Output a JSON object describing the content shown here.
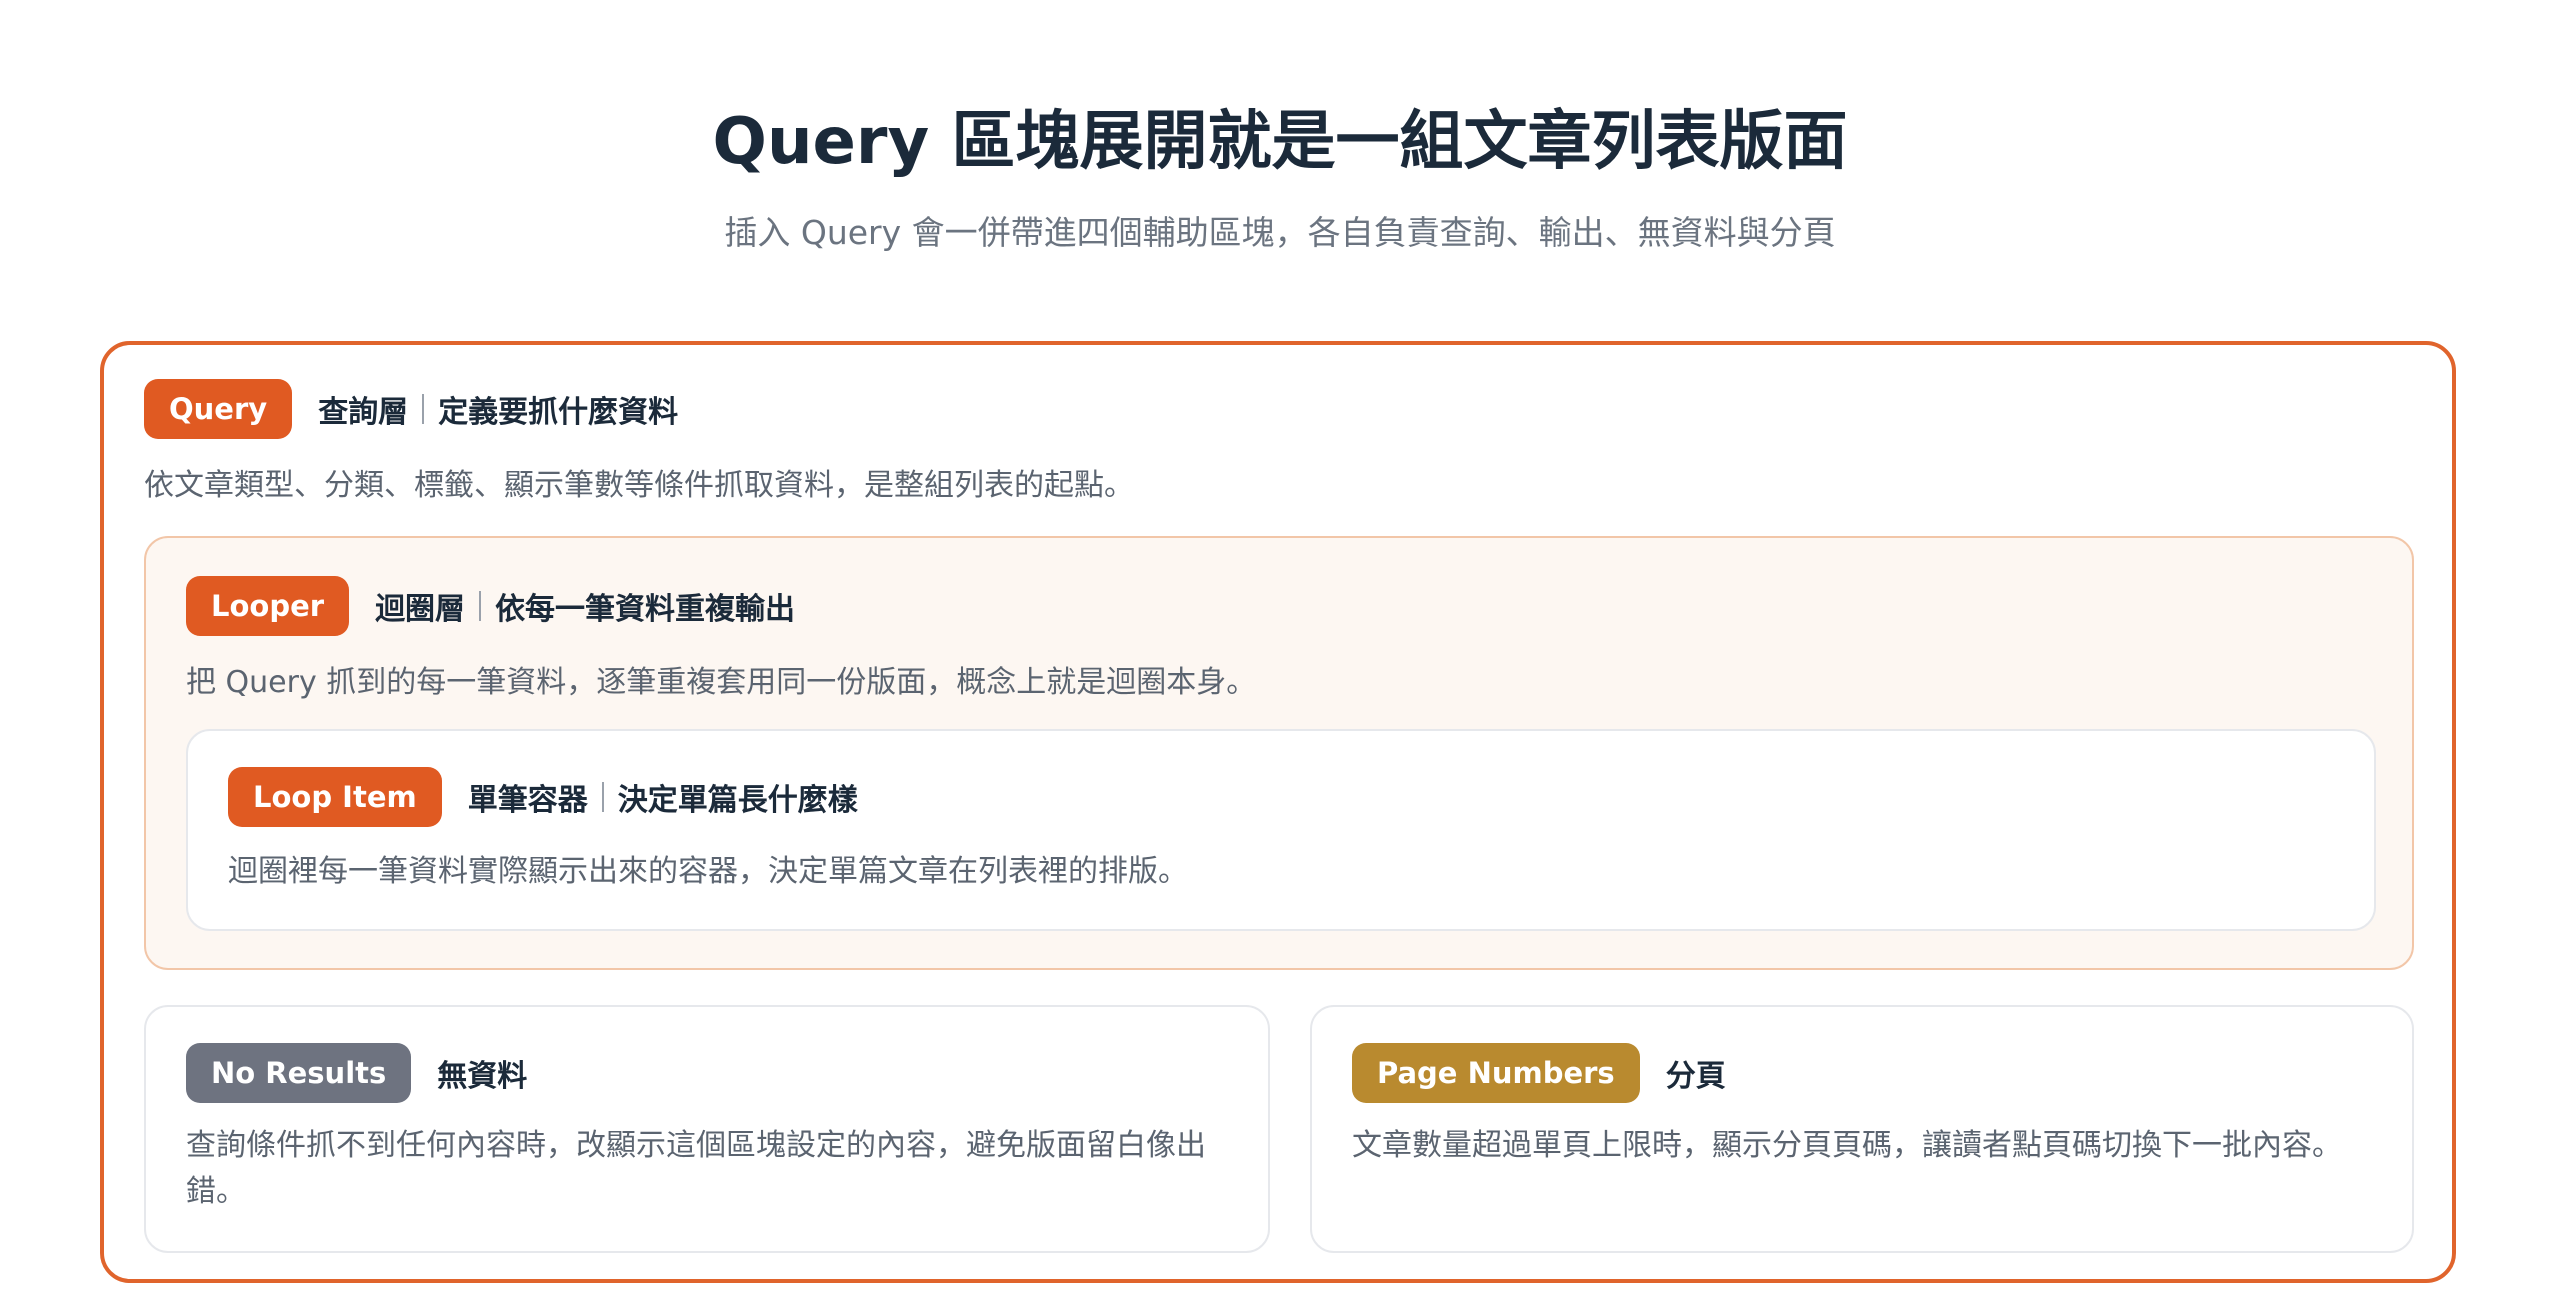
{
  "header": {
    "title": "Query 區塊展開就是一組文章列表版面",
    "subtitle": "插入 Query 會一併帶進四個輔助區塊，各自負責查詢、輸出、無資料與分頁"
  },
  "colors": {
    "outer_border": "#e0642c",
    "badge_orange": "#e05a22",
    "badge_gray": "#6e7380",
    "badge_gold": "#b98a2f",
    "looper_bg": "#fdf7f2",
    "looper_border": "#f2c6a8"
  },
  "query": {
    "badge": "Query",
    "name": "查詢層",
    "role": "定義要抓什麼資料",
    "description": "依文章類型、分類、標籤、顯示筆數等條件抓取資料，是整組列表的起點。"
  },
  "looper": {
    "badge": "Looper",
    "name": "迴圈層",
    "role": "依每一筆資料重複輸出",
    "description": "把 Query 抓到的每一筆資料，逐筆重複套用同一份版面，概念上就是迴圈本身。"
  },
  "loop_item": {
    "badge": "Loop Item",
    "name": "單筆容器",
    "role": "決定單篇長什麼樣",
    "description": "迴圈裡每一筆資料實際顯示出來的容器，決定單篇文章在列表裡的排版。"
  },
  "no_results": {
    "badge": "No Results",
    "name": "無資料",
    "description": "查詢條件抓不到任何內容時，改顯示這個區塊設定的內容，避免版面留白像出錯。"
  },
  "page_numbers": {
    "badge": "Page Numbers",
    "name": "分頁",
    "description": "文章數量超過單頁上限時，顯示分頁頁碼，讓讀者點頁碼切換下一批內容。"
  }
}
